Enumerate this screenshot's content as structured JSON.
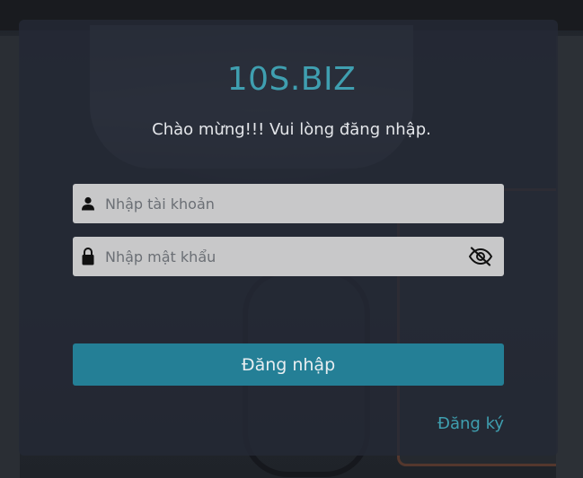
{
  "brand": {
    "title": "10S.BIZ"
  },
  "welcome_text": "Chào mừng!!! Vui lòng đăng nhập.",
  "username": {
    "placeholder": "Nhập tài khoản",
    "value": ""
  },
  "password": {
    "placeholder": "Nhập mật khẩu",
    "value": ""
  },
  "login_button": {
    "label": "Đăng nhập"
  },
  "register_link": {
    "label": "Đăng ký"
  },
  "icons": {
    "username": "user-icon",
    "password": "lock-icon",
    "toggle_password": "eye-off-icon"
  },
  "colors": {
    "brand": "#3f9fb0",
    "button": "#247f96",
    "field_bg": "#c8c8c9",
    "card_bg": "#242a36"
  }
}
